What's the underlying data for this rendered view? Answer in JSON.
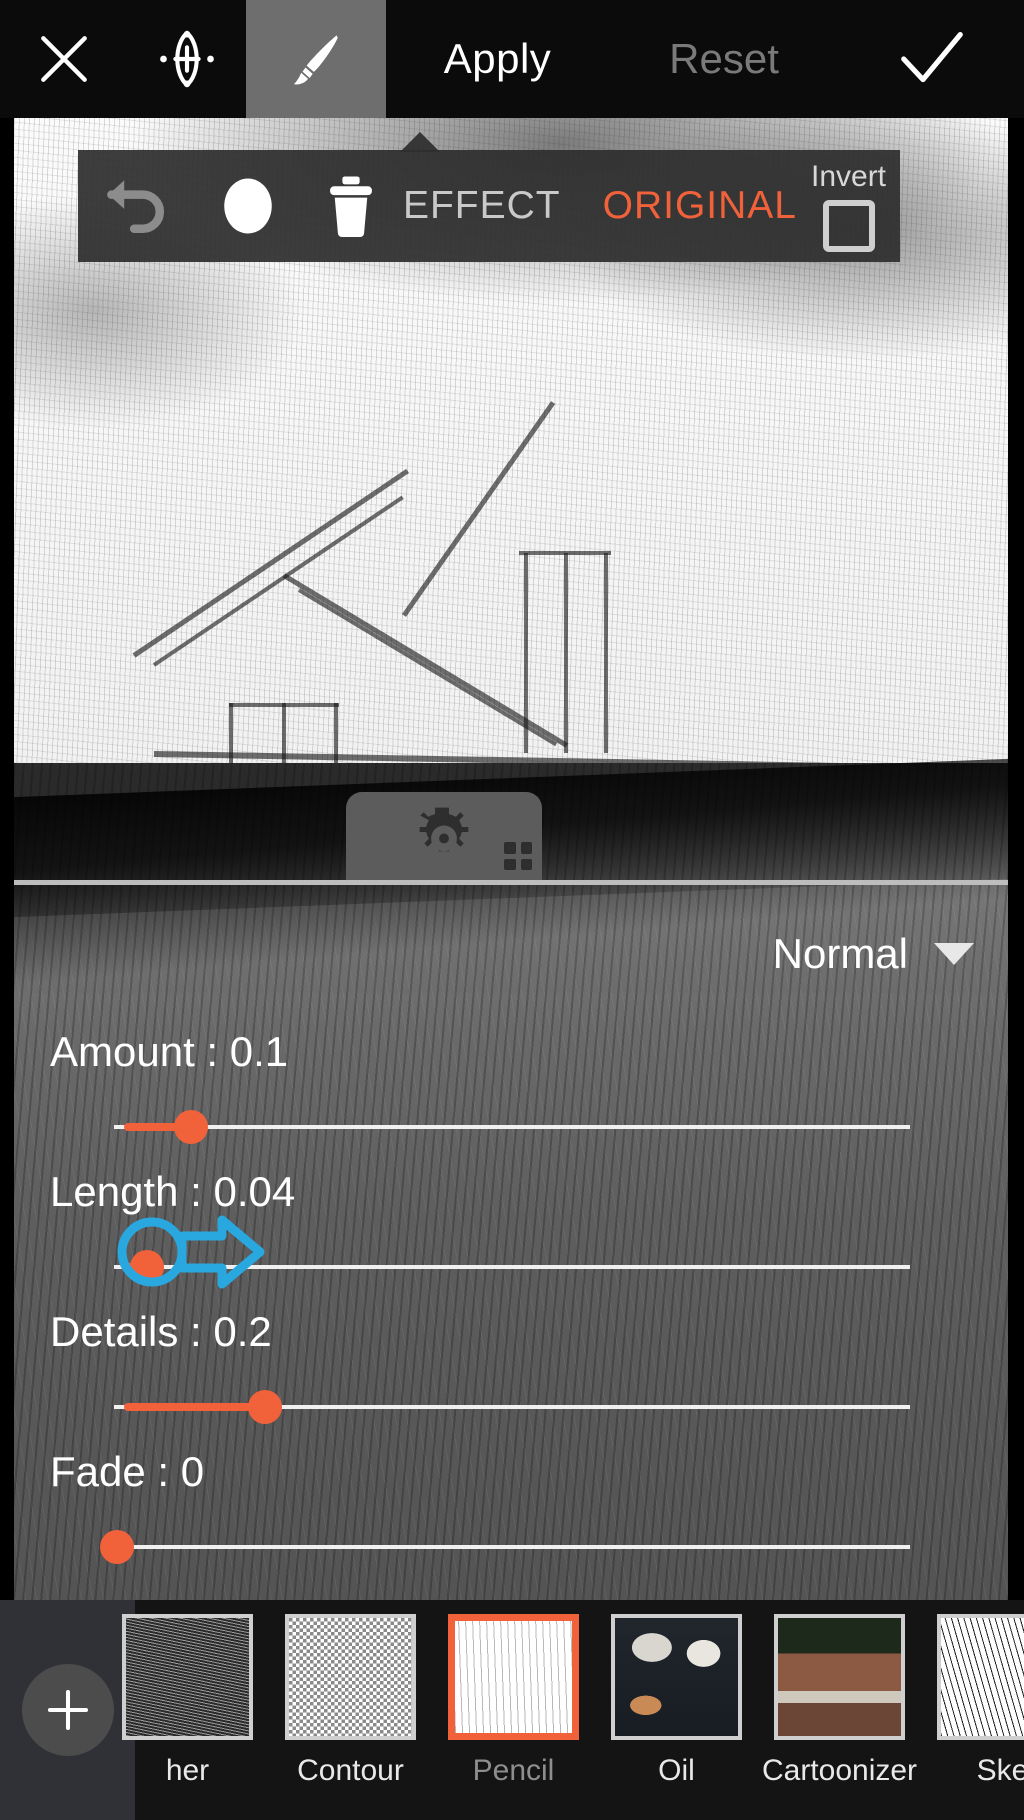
{
  "topbar": {
    "close_icon": "close-x-icon",
    "transform_icon": "move-target-icon",
    "brush_icon": "paintbrush-icon",
    "apply_label": "Apply",
    "reset_label": "Reset",
    "confirm_icon": "checkmark-icon"
  },
  "effect_toolbar": {
    "undo_icon": "undo-arrow-icon",
    "brush_size_icon": "filled-circle-icon",
    "delete_icon": "trash-can-icon",
    "effect_label": "EFFECT",
    "original_label": "ORIGINAL",
    "invert_label": "Invert",
    "invert_checked": false,
    "active_mode": "ORIGINAL"
  },
  "canvas": {
    "settings_icon": "gear-icon",
    "resize_grip_icon": "grip-dots-icon"
  },
  "controls": {
    "blend_mode": "Normal",
    "blend_caret_icon": "chevron-down-icon",
    "sliders": [
      {
        "label": "Amount : 0.1",
        "name": "amount",
        "value": 0.1,
        "percent": 8
      },
      {
        "label": "Length : 0.04",
        "name": "length",
        "value": 0.04,
        "percent": 4
      },
      {
        "label": "Details : 0.2",
        "name": "details",
        "value": 0.2,
        "percent": 18
      },
      {
        "label": "Fade : 0",
        "name": "fade",
        "value": 0,
        "percent": 0
      }
    ]
  },
  "gesture": {
    "name": "drag-right-annotation",
    "target_slider": "amount",
    "direction": "right"
  },
  "filmstrip": {
    "add_icon": "plus-icon",
    "thumbnails": [
      {
        "label": "her",
        "name": "feather",
        "selected": false,
        "swatch": "t-feather"
      },
      {
        "label": "Contour",
        "name": "contour",
        "selected": false,
        "swatch": "t-contour"
      },
      {
        "label": "Pencil",
        "name": "pencil",
        "selected": true,
        "swatch": "t-pencil"
      },
      {
        "label": "Oil",
        "name": "oil",
        "selected": false,
        "swatch": "t-oil"
      },
      {
        "label": "Cartoonizer",
        "name": "cartoonizer",
        "selected": false,
        "swatch": "t-cartoon"
      },
      {
        "label": "Ske",
        "name": "sketcher",
        "selected": false,
        "swatch": "t-sketch"
      }
    ]
  },
  "colors": {
    "accent": "#f2623a",
    "topbar_bg": "#0b0b0b",
    "active_tool_bg": "#6e6e6e",
    "annotation": "#29a8e0",
    "track": "#f0f0f0"
  }
}
